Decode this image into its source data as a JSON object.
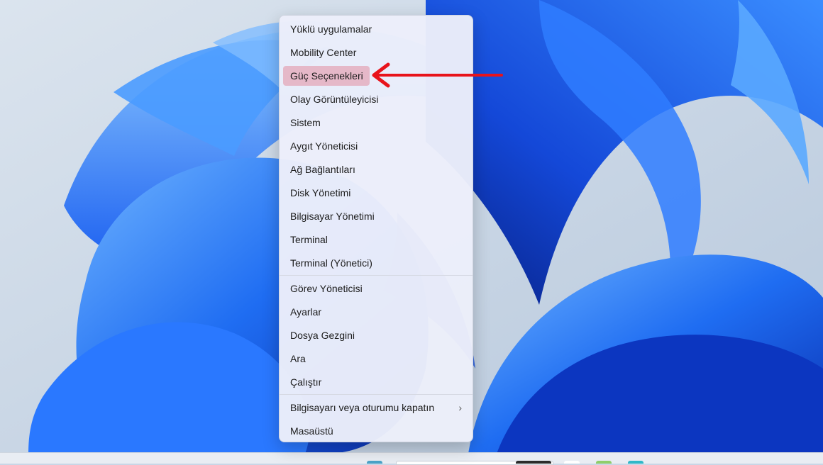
{
  "context_menu": {
    "items": [
      {
        "label": "Yüklü uygulamalar"
      },
      {
        "label": "Mobility Center"
      },
      {
        "label": "Güç Seçenekleri",
        "highlighted": true
      },
      {
        "label": "Olay Görüntüleyicisi"
      },
      {
        "label": "Sistem"
      },
      {
        "label": "Aygıt Yöneticisi"
      },
      {
        "label": "Ağ Bağlantıları"
      },
      {
        "label": "Disk Yönetimi"
      },
      {
        "label": "Bilgisayar Yönetimi"
      },
      {
        "label": "Terminal"
      },
      {
        "label": "Terminal (Yönetici)"
      },
      {
        "label": "Görev Yöneticisi"
      },
      {
        "label": "Ayarlar"
      },
      {
        "label": "Dosya Gezgini"
      },
      {
        "label": "Ara"
      },
      {
        "label": "Çalıştır"
      },
      {
        "label": "Bilgisayarı veya oturumu kapatın",
        "has_submenu": true
      },
      {
        "label": "Masaüstü"
      }
    ],
    "submenu_icon": "chevron-right-icon",
    "highlight_color": "#e5b8c8"
  },
  "annotation": {
    "arrow_color": "#e8131b",
    "points_to": "Güç Seçenekleri"
  },
  "colors": {
    "wallpaper_bg": "#c9d6e6",
    "wallpaper_accent": "#1a5ef0"
  }
}
